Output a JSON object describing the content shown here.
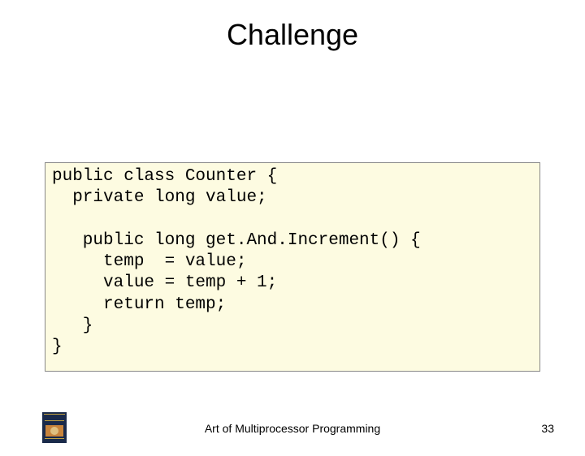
{
  "title": "Challenge",
  "code": "public class Counter {\n  private long value;\n\n   public long get.And.Increment() {\n     temp  = value;\n     value = temp + 1;\n     return temp;\n   }\n}",
  "caption": "Art of Multiprocessor Programming",
  "page": "33"
}
